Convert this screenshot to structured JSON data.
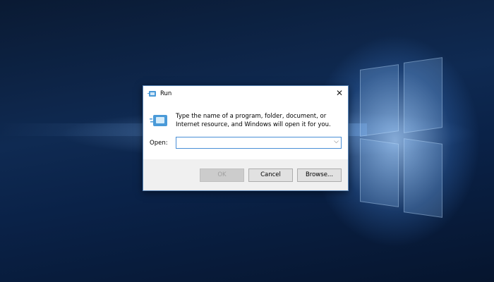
{
  "dialog": {
    "title": "Run",
    "message": "Type the name of a program, folder, document, or Internet resource, and Windows will open it for you.",
    "open_label": "Open:",
    "open_value": "",
    "buttons": {
      "ok": "OK",
      "cancel": "Cancel",
      "browse": "Browse..."
    }
  },
  "icons": {
    "title": "run-icon",
    "close": "close-icon",
    "dropdown": "chevron-down-icon"
  }
}
